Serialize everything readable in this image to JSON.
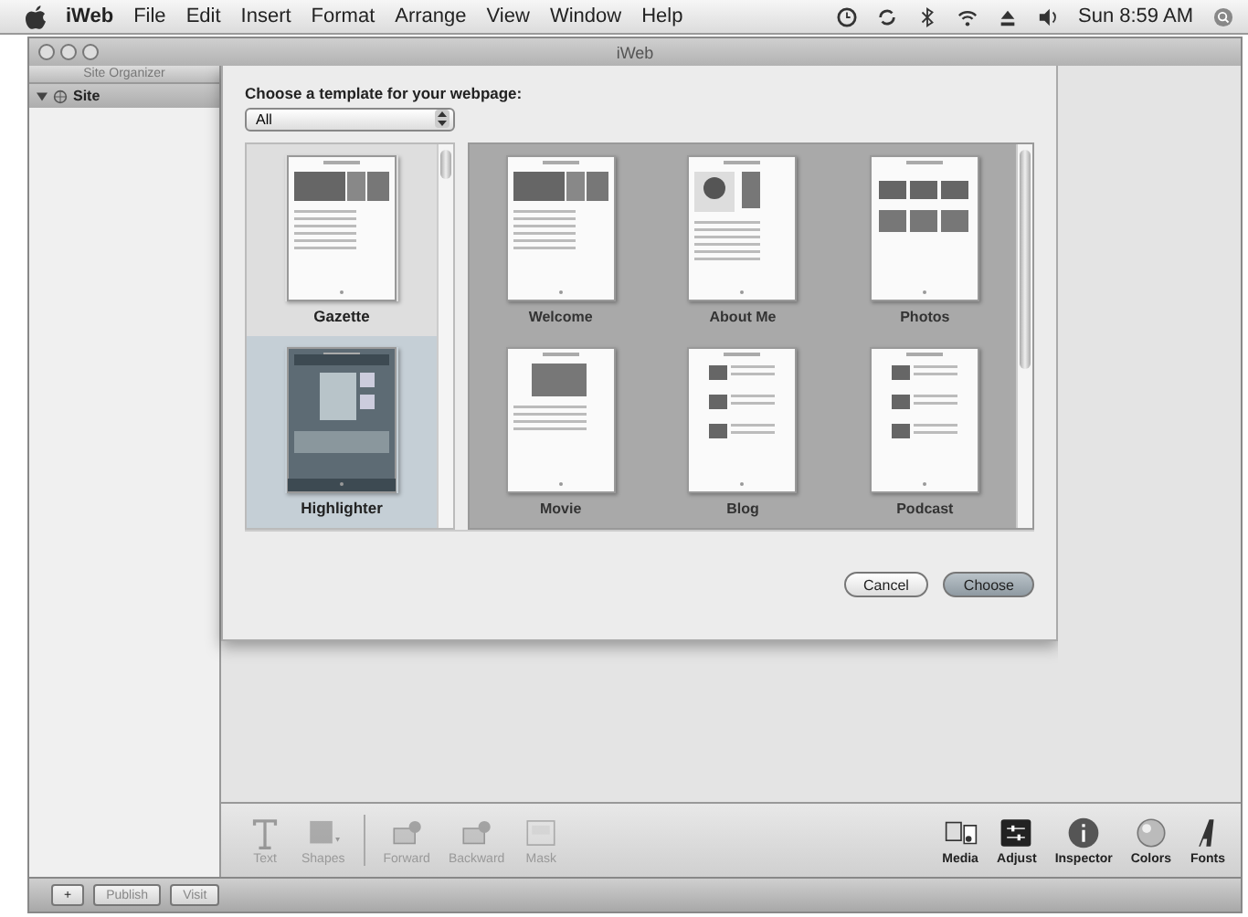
{
  "menu_bar": {
    "app": "iWeb",
    "items": [
      "File",
      "Edit",
      "Insert",
      "Format",
      "Arrange",
      "View",
      "Window",
      "Help"
    ],
    "clock": "Sun 8:59 AM"
  },
  "window": {
    "title": "iWeb"
  },
  "sidebar": {
    "header": "Site Organizer",
    "items": [
      {
        "label": "Site",
        "expanded": true
      }
    ]
  },
  "template_sheet": {
    "prompt": "Choose a template for your webpage:",
    "filter": "All",
    "themes": [
      {
        "name": "Gazette",
        "selected": false,
        "kind": "plain"
      },
      {
        "name": "Highlighter",
        "selected": true,
        "kind": "dark"
      }
    ],
    "pages": [
      {
        "name": "Welcome",
        "kind": "banner"
      },
      {
        "name": "About Me",
        "kind": "portrait"
      },
      {
        "name": "Photos",
        "kind": "grid"
      },
      {
        "name": "Movie",
        "kind": "movie"
      },
      {
        "name": "Blog",
        "kind": "list"
      },
      {
        "name": "Podcast",
        "kind": "list"
      }
    ],
    "buttons": [
      {
        "label": "Cancel",
        "default": false
      },
      {
        "label": "Choose",
        "default": true
      }
    ]
  },
  "toolbar": {
    "left": [
      {
        "label": "Text",
        "kind": "text",
        "disabled": true
      },
      {
        "label": "Shapes",
        "kind": "shapes",
        "disabled": true
      },
      {
        "label": "Forward",
        "kind": "forward",
        "disabled": true
      },
      {
        "label": "Backward",
        "kind": "backward",
        "disabled": true
      },
      {
        "label": "Mask",
        "kind": "mask",
        "disabled": true
      }
    ],
    "right": [
      {
        "label": "Media",
        "kind": "media",
        "disabled": false
      },
      {
        "label": "Adjust",
        "kind": "adjust",
        "disabled": false
      },
      {
        "label": "Inspector",
        "kind": "inspector",
        "disabled": false
      },
      {
        "label": "Colors",
        "kind": "colors",
        "disabled": false
      },
      {
        "label": "Fonts",
        "kind": "fonts",
        "disabled": false
      }
    ]
  },
  "bottom_bar": {
    "buttons": [
      {
        "label": "+",
        "disabled": false
      },
      {
        "label": "Publish",
        "disabled": true
      },
      {
        "label": "Visit",
        "disabled": true
      }
    ]
  }
}
